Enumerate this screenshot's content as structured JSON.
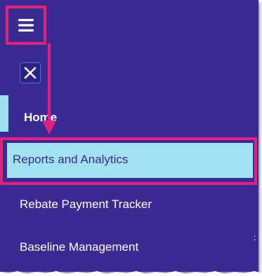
{
  "header": {
    "menu_icon": "hamburger-menu-icon"
  },
  "drawer": {
    "close_icon": "close-icon",
    "items": [
      {
        "label": "Home",
        "active": false
      },
      {
        "label": "Reports and Analytics",
        "active": true
      },
      {
        "label": "Rebate Payment Tracker",
        "active": false
      },
      {
        "label": "Baseline Management",
        "active": false
      }
    ]
  },
  "colors": {
    "background": "#3a2a94",
    "highlight_fill": "#a0e1f2",
    "highlight_border": "#e0227c",
    "text": "#ffffff",
    "active_text": "#3a2a94"
  }
}
